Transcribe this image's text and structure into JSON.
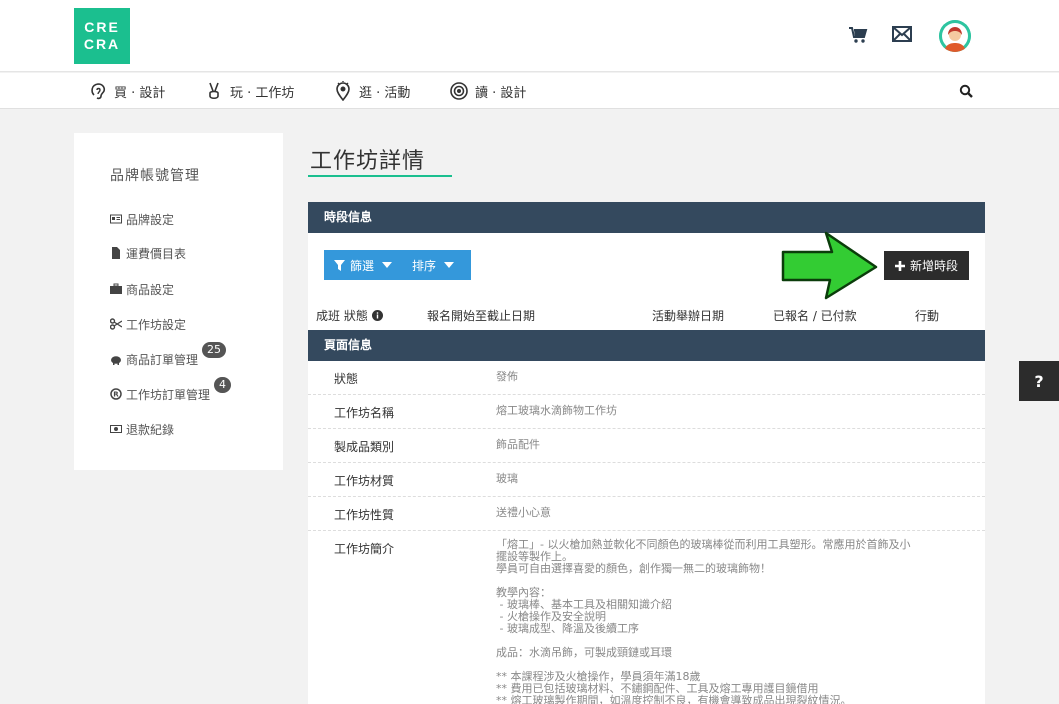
{
  "logo": {
    "line1": "CRE",
    "line2": "CRA"
  },
  "header": {
    "icons": [
      "cart-icon",
      "mail-icon",
      "avatar"
    ]
  },
  "nav": {
    "items": [
      {
        "label": "買 · 設計",
        "icon": "ear-icon"
      },
      {
        "label": "玩 · 工作坊",
        "icon": "peace-hand-icon"
      },
      {
        "label": "逛 · 活動",
        "icon": "location-icon"
      },
      {
        "label": "讀 · 設計",
        "icon": "eye-icon"
      }
    ]
  },
  "sidebar": {
    "title": "品牌帳號管理",
    "items": [
      {
        "label": "品牌設定",
        "icon": "id-card-icon"
      },
      {
        "label": "運費價目表",
        "icon": "document-icon"
      },
      {
        "label": "商品設定",
        "icon": "briefcase-icon"
      },
      {
        "label": "工作坊設定",
        "icon": "scissors-icon"
      },
      {
        "label": "商品訂單管理",
        "icon": "piggy-bank-icon",
        "badge": "25"
      },
      {
        "label": "工作坊訂單管理",
        "icon": "registered-icon",
        "badge": "4"
      },
      {
        "label": "退款紀錄",
        "icon": "money-icon"
      }
    ]
  },
  "main": {
    "title": "工作坊詳情",
    "session_header": "時段信息",
    "filter_label": "篩選",
    "sort_label": "排序",
    "add_session_label": "新增時段",
    "columns": [
      "成班 狀態",
      "報名開始至截止日期",
      "活動舉辦日期",
      "已報名 / 已付款",
      "行動"
    ],
    "page_header": "頁面信息",
    "info_rows": [
      {
        "label": "狀態",
        "value": "發佈"
      },
      {
        "label": "工作坊名稱",
        "value": "熔工玻璃水滴飾物工作坊"
      },
      {
        "label": "製成品類別",
        "value": "飾品配件"
      },
      {
        "label": "工作坊材質",
        "value": "玻璃"
      },
      {
        "label": "工作坊性質",
        "value": "送禮小心意"
      },
      {
        "label": "工作坊簡介",
        "value": ""
      }
    ],
    "description": [
      "「熔工」- 以火槍加熱並軟化不同顏色的玻璃棒從而利用工具塑形。常應用於首飾及小",
      "擺設等製作上。",
      "學員可自由選擇喜愛的顏色，創作獨一無二的玻璃飾物！",
      "",
      "教學內容：",
      " - 玻璃棒、基本工具及相關知識介紹",
      " - 火槍操作及安全說明",
      " - 玻璃成型、降溫及後續工序",
      "",
      "成品：水滴吊飾，可製成頸鏈或耳環",
      "",
      "** 本課程涉及火槍操作，學員須年滿18歲",
      "** 費用已包括玻璃材料、不鏽鋼配件、工具及熔工專用護目鏡借用",
      "** 熔工玻璃製作期間，如溫度控制不良，有機會導致成品出現裂紋情況。"
    ]
  },
  "help": {
    "label": "?"
  },
  "colors": {
    "brand": "#1bbf8f",
    "header_bar": "#34495e",
    "filter": "#3498db",
    "arrow": "#33cc33"
  }
}
